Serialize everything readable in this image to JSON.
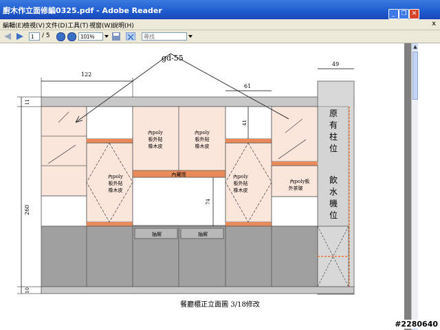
{
  "window": {
    "title": "廚木作立面修編0325.pdf - Adobe Reader",
    "minimize_glyph": "_",
    "restore_glyph": "❐",
    "close_glyph": "✕"
  },
  "menu": {
    "items": [
      "編輯(E)",
      "檢視(V)",
      "文件(D)",
      "工具(T)",
      "視窗(W)",
      "說明(H)"
    ],
    "close_glyph": "x"
  },
  "toolbar": {
    "page_current": "1",
    "page_total": "/ 5",
    "zoom": "101%",
    "search_placeholder": "尋找"
  },
  "drawing": {
    "handwritten_note": "gd-55",
    "dim_top_left": "122",
    "dim_top_mid": "61",
    "dim_top_right": "49",
    "dim_side_top": "11",
    "dim_height": "260",
    "dim_side_bottom": "10",
    "dim_inner_41": "41",
    "dim_inner_74": "74",
    "label_center_top_left": [
      "內poly",
      "板外貼",
      "橡木皮"
    ],
    "label_center_top_right": [
      "內poly",
      "板外貼",
      "橡木皮"
    ],
    "label_hidden_light": "內藏燈",
    "label_left_diamond": [
      "內poly",
      "板外貼",
      "橡木皮"
    ],
    "label_right_diamond": [
      "內poly",
      "板外貼",
      "橡木皮"
    ],
    "label_right_glass": [
      "內poly板",
      "外茶玻"
    ],
    "label_existing_pillar": [
      "原",
      "有",
      "柱",
      "位"
    ],
    "label_water_dispenser": [
      "飲",
      "水",
      "機",
      "位"
    ],
    "label_drawer_left": "抽屜",
    "label_drawer_right": "抽屜",
    "caption": "餐廳櫃正立面圖   3/18修改"
  },
  "watermark": "#2280640",
  "colors": {
    "peach": "#fbe6dc",
    "orange": "#e88a5a",
    "grey_top": "#c8c8c8",
    "grey_cab": "#a0a0a0",
    "grey_column": "#d8d8d8"
  }
}
